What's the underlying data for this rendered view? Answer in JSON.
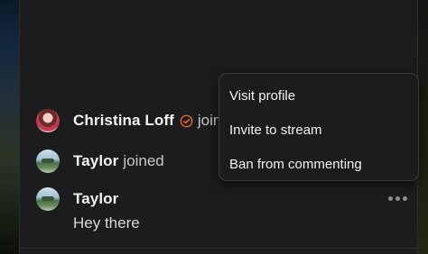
{
  "chat": {
    "messages": [
      {
        "user": "Christina Loff",
        "text": "joined",
        "avatar_icon": "avatar-christina",
        "badge_icon": "verified-check-icon",
        "badge_color": "#e8692c"
      },
      {
        "user": "Taylor",
        "text": "joined",
        "avatar_icon": "avatar-taylor"
      },
      {
        "user": "Taylor",
        "text": "Hey there",
        "avatar_icon": "avatar-taylor"
      }
    ],
    "more_icon": "more-options-icon"
  },
  "context_menu": {
    "items": [
      {
        "label": "Visit profile"
      },
      {
        "label": "Invite to stream"
      },
      {
        "label": "Ban from commenting"
      }
    ]
  },
  "colors": {
    "background": "#1c1c1e",
    "menu_border": "#3a3a3e",
    "text_primary": "#f2f2f4",
    "text_secondary": "#c7c7cc"
  }
}
